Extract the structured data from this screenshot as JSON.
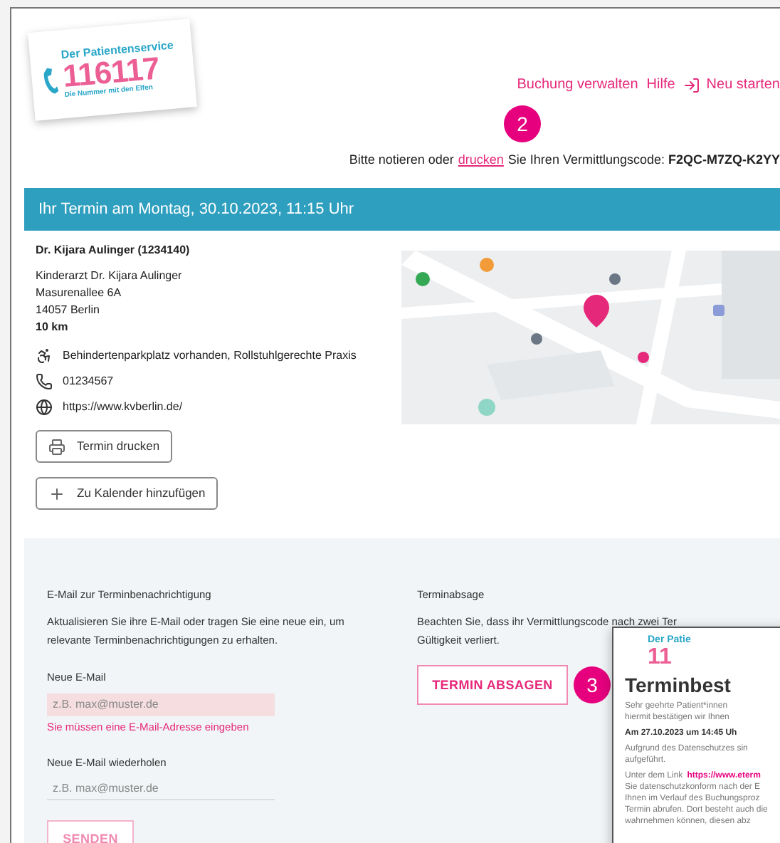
{
  "logo": {
    "title": "Der Patientenservice",
    "number": "116117",
    "slogan": "Die Nummer mit den Elfen"
  },
  "nav": [
    {
      "label": "Buchung verwalten",
      "kind": "link"
    },
    {
      "label": "Hilfe",
      "kind": "link"
    },
    {
      "label": "Neu starten",
      "kind": "restart"
    }
  ],
  "step_badges": [
    "2",
    "3"
  ],
  "code_notice": {
    "before": "Bitte notieren oder",
    "link": "drucken",
    "after": "Sie Ihren Vermittlungscode: **F2QC-M7ZQ-K2YY**"
  },
  "appointment": {
    "title": "Ihr Termin am Montag, 30.10.2023, 11:15 Uhr",
    "doctor": "Dr. Kijara Aulinger (1234140)",
    "address": [
      "Kinderarzt Dr. Kijara Aulinger",
      "Masurenallee 6A",
      "14057 Berlin"
    ],
    "distance": "10 km",
    "features": [
      {
        "kind": "accessibility",
        "text": "Behindertenparkplatz vorhanden, Rollstuhlgerechte Praxis"
      },
      {
        "kind": "phone",
        "text": "01234567"
      },
      {
        "kind": "web",
        "text": "https://www.kvberlin.de/"
      }
    ],
    "buttons": [
      {
        "kind": "print",
        "label": "Termin drucken"
      },
      {
        "kind": "add",
        "label": "Zu Kalender hinzufügen"
      }
    ],
    "map": {
      "kind": "picture"
    }
  },
  "email": {
    "heading": "E-Mail zur Terminbenachrichtigung",
    "text": "Aktualisieren Sie ihre E-Mail oder tragen Sie eine neue ein, um relevante Terminbenachrichtigungen zu erhalten.",
    "fields": [
      {
        "label": "Neue E-Mail",
        "placeholder": "z.B. max@muster.de",
        "error": "Sie müssen eine E-Mail-Adresse eingeben"
      },
      {
        "label": "Neue E-Mail wiederholen",
        "placeholder": "z.B. max@muster.de"
      }
    ],
    "submit": {
      "label": "SENDEN",
      "disabled": true
    }
  },
  "cancel": {
    "heading": "Terminabsage",
    "text": "Beachten Sie, dass ihr Vermittlungscode nach zwei Ter",
    "text2": "Gültigkeit verliert.",
    "button": "TERMIN ABSAGEN"
  },
  "letter": {
    "logo_title": "Der Patie",
    "logo_number": "11",
    "heading": "Terminbest",
    "greeting": [
      "Sehr geehrte Patient*innen",
      "hiermit bestätigen wir Ihnen"
    ],
    "date": "Am 27.10.2023 um 14:45 Uh",
    "lines": [
      "Aufgrund des Datenschutzes sin",
      "aufgeführt."
    ],
    "link_before": "Unter dem Link",
    "link": "https://www.eterm",
    "body": [
      "Sie datenschutzkonform nach der E",
      "Ihnen im Verlauf des Buchungsproz",
      "Termin abrufen. Dort besteht auch die",
      "wahrnehmen können, diesen abz"
    ]
  }
}
